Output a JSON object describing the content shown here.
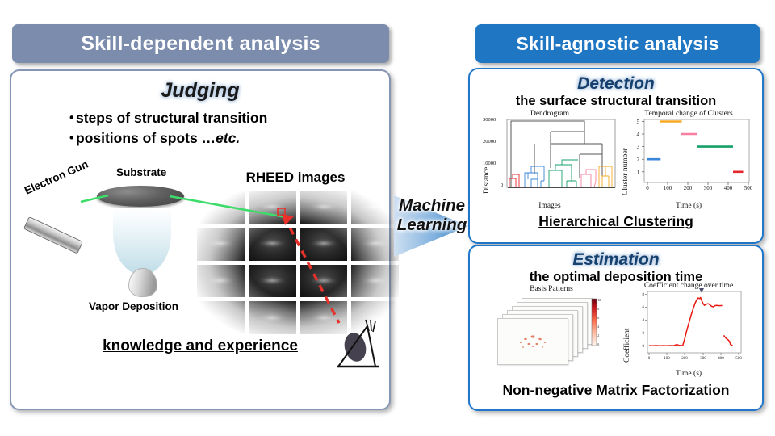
{
  "left": {
    "banner": "Skill-dependent analysis",
    "emphasis": "Judging",
    "bullets": [
      {
        "dot": "・",
        "text": "steps of structural transition",
        "tail": ""
      },
      {
        "dot": "・",
        "text": "positions of spots …",
        "tail": "etc."
      }
    ],
    "apparatus": {
      "substrate_label": "Substrate",
      "electron_gun_label": "Electron Gun",
      "vapor_label": "Vapor Deposition"
    },
    "rheed_title": "RHEED images",
    "footer": "knowledge and experience"
  },
  "middle": {
    "arrow_line1": "Machine",
    "arrow_line2": "Learning",
    "arrow_color": "#5b9bd5"
  },
  "right": {
    "banner": "Skill-agnostic analysis",
    "detection": {
      "emphasis": "Detection",
      "subtitle": "the surface structural transition",
      "method": "Hierarchical Clustering"
    },
    "estimation": {
      "emphasis": "Estimation",
      "subtitle": "the optimal deposition time",
      "method": "Non-negative Matrix Factorization"
    }
  },
  "colors": {
    "header_gray_blue": "#7b8cac",
    "header_blue": "#1f77c4",
    "panel_border_blue": "#2076c8",
    "panel_border_gray": "#8596b4",
    "cluster_red": "#e8272c",
    "cluster_blue": "#3a86d8",
    "cluster_green": "#16a06a",
    "cluster_pink": "#f77fa1",
    "cluster_orange": "#f9a826",
    "coefficient_line": "#e8170f",
    "beam_green": "#3ddc6a",
    "dashed_red": "#e8312a"
  },
  "chart_data": [
    {
      "type": "dendrogram",
      "title": "Dendrogram",
      "xlabel": "Images",
      "ylabel": "Distance",
      "ylim": [
        0,
        30000
      ],
      "yticks": [
        0,
        10000,
        20000,
        30000
      ],
      "ytick_labels": [
        "0",
        "10000",
        "20000",
        "30000"
      ],
      "n_clusters": 5,
      "cluster_colors": [
        "#e8272c",
        "#3a86d8",
        "#16a06a",
        "#f77fa1",
        "#f9a826"
      ],
      "cluster_order": [
        "red",
        "blue",
        "green",
        "pink",
        "orange"
      ],
      "merge_heights": [
        29000,
        24500,
        20000,
        15000
      ],
      "cluster_spans_pct": [
        [
          2,
          14
        ],
        [
          15,
          30
        ],
        [
          31,
          58
        ],
        [
          59,
          75
        ],
        [
          76,
          99
        ]
      ],
      "cluster_tops": [
        3500,
        6600,
        5800,
        4600,
        7200
      ],
      "grid": false,
      "legend": "none"
    },
    {
      "type": "line",
      "title": "Temporal change of Clusters",
      "xlabel": "Time (s)",
      "ylabel": "Cluster number",
      "xlim": [
        -20,
        500
      ],
      "ylim": [
        0.5,
        5.5
      ],
      "xticks": [
        0,
        100,
        200,
        300,
        400,
        500
      ],
      "yticks": [
        1,
        2,
        3,
        4,
        5
      ],
      "grid": false,
      "legend": "none",
      "series": [
        {
          "name": "cluster-2",
          "color": "#3a86d8",
          "y": 2,
          "x_start": 0,
          "x_end": 65
        },
        {
          "name": "cluster-5",
          "color": "#f9a826",
          "y": 5,
          "x_start": 62,
          "x_end": 170
        },
        {
          "name": "cluster-4",
          "color": "#f77fa1",
          "y": 4,
          "x_start": 168,
          "x_end": 246
        },
        {
          "name": "cluster-3",
          "color": "#16a06a",
          "y": 3,
          "x_start": 245,
          "x_end": 424
        },
        {
          "name": "cluster-1",
          "color": "#e8272c",
          "y": 1,
          "x_start": 424,
          "x_end": 474
        }
      ]
    },
    {
      "type": "image-stack",
      "title": "Basis Patterns",
      "n_sheets": 6,
      "colorbar": {
        "ticks": [
          "10",
          "8",
          "6",
          "4",
          "2",
          "0"
        ],
        "cmap": "Reds"
      }
    },
    {
      "type": "line",
      "title": "Coefficient change over time",
      "xlabel": "Time (s)",
      "ylabel": "Coefficient",
      "xlim": [
        -10,
        500
      ],
      "ylim": [
        -0.6,
        8.6
      ],
      "xticks": [
        0,
        100,
        200,
        300,
        400,
        500
      ],
      "yticks": [
        0,
        2,
        4,
        6,
        8
      ],
      "grid": false,
      "legend": "none",
      "annotation_marker": {
        "shape": "triangle-down",
        "x": 288,
        "color": "#4b4b6b"
      },
      "series": [
        {
          "name": "coefficient",
          "color": "#e8170f",
          "x": [
            0,
            20,
            40,
            60,
            80,
            100,
            120,
            140,
            155,
            170,
            182,
            190,
            200,
            212,
            224,
            236,
            248,
            258,
            268,
            276,
            284,
            290,
            296,
            304,
            312,
            322,
            332,
            342,
            352,
            362,
            372,
            382,
            392,
            402,
            412
          ],
          "y": [
            0.05,
            0.03,
            0.06,
            0.04,
            0.05,
            0.03,
            0.06,
            0.05,
            0.22,
            0.1,
            0.05,
            0.1,
            1.05,
            2.35,
            3.55,
            4.7,
            5.75,
            6.55,
            7.15,
            7.45,
            7.35,
            7.5,
            7.05,
            6.55,
            6.3,
            6.45,
            6.55,
            6.4,
            6.15,
            6.05,
            6.3,
            6.32,
            6.28,
            6.3,
            6.3
          ]
        },
        {
          "name": "coefficient-tail",
          "color": "#e8170f",
          "x": [
            420,
            428,
            436,
            444,
            452,
            458,
            464,
            470
          ],
          "y": [
            1.62,
            1.35,
            1.1,
            0.95,
            0.7,
            0.22,
            0.12,
            0.08
          ]
        }
      ]
    }
  ]
}
